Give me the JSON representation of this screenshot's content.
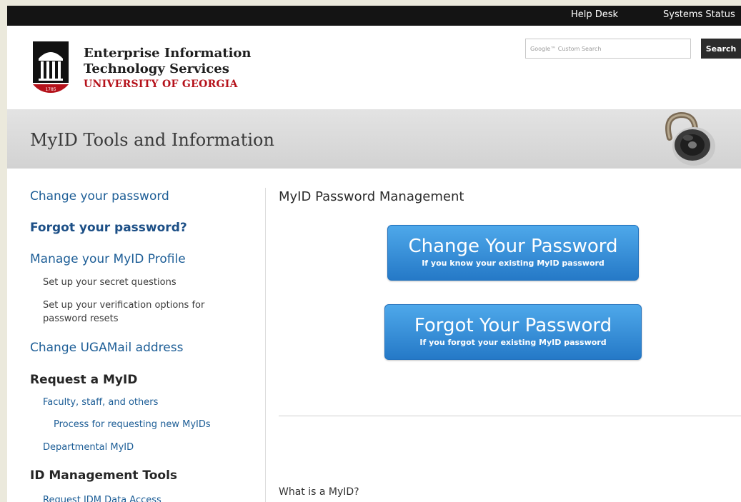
{
  "topbar": {
    "links": [
      "Help Desk",
      "Systems Status"
    ]
  },
  "header": {
    "brand_line1": "Enterprise Information",
    "brand_line2": "Technology Services",
    "brand_line3": "UNIVERSITY OF GEORGIA",
    "logo_year": "1785",
    "search_placeholder": "Google™ Custom Search",
    "search_button": "Search"
  },
  "band": {
    "title": "MyID Tools and Information"
  },
  "sidebar": {
    "items": [
      {
        "label": "Change your password"
      },
      {
        "label": "Forgot your password?"
      },
      {
        "label": "Manage your MyID Profile"
      },
      {
        "label": "Set up your secret questions"
      },
      {
        "label": "Set up your verification options for"
      },
      {
        "label": "password resets"
      },
      {
        "label": "Change UGAMail address"
      },
      {
        "label": "Request a MyID"
      },
      {
        "label": "Faculty, staff, and others"
      },
      {
        "label": "Process for requesting new MyIDs"
      },
      {
        "label": "Departmental MyID"
      },
      {
        "label": "ID Management Tools"
      },
      {
        "label": "Request IDM Data Access"
      }
    ]
  },
  "main": {
    "title": "MyID Password Management",
    "change_button": {
      "title": "Change Your Password",
      "subtitle": "If you know your existing MyID password"
    },
    "forgot_button": {
      "title": "Forgot Your Password",
      "subtitle": "If you forgot your existing MyID password"
    },
    "what_is": "What is a MyID?"
  },
  "colors": {
    "accent_blue": "#2f86d6",
    "link_blue": "#1c5d96",
    "brand_red": "#b5121b",
    "topbar": "#141414"
  }
}
